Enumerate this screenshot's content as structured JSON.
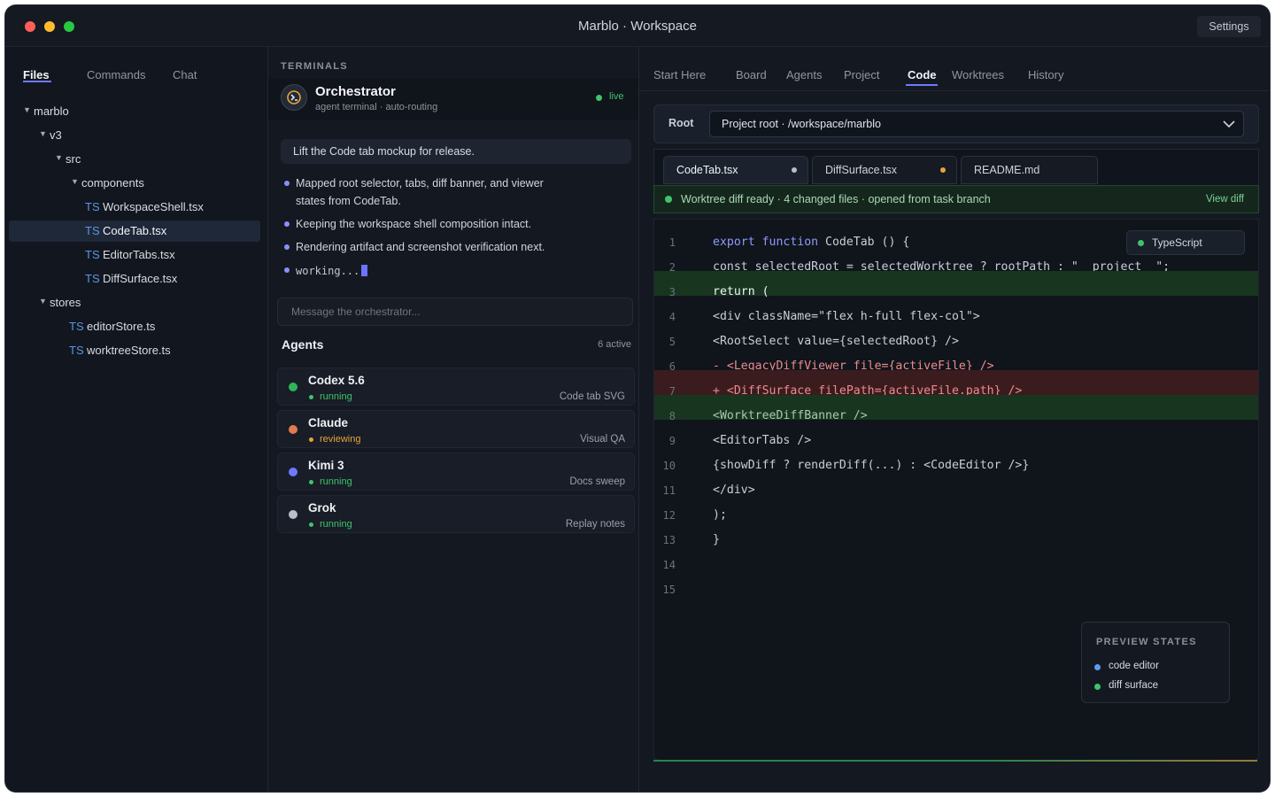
{
  "window": {
    "title": "Marblo · Workspace",
    "settings_label": "Settings",
    "traffic_lights": {
      "close": "#ff5f57",
      "minimize": "#febc2e",
      "zoom": "#28c840"
    }
  },
  "left": {
    "tabs": [
      {
        "label": "Files"
      },
      {
        "label": "Commands"
      },
      {
        "label": "Chat"
      }
    ],
    "tree": [
      {
        "label": "marblo",
        "type": "folder"
      },
      {
        "label": "v3",
        "type": "folder"
      },
      {
        "label": "src",
        "type": "folder"
      },
      {
        "label": "components",
        "type": "folder"
      },
      {
        "label": "WorkspaceShell.tsx",
        "type": "file",
        "badge": "TS"
      },
      {
        "label": "CodeTab.tsx",
        "type": "file",
        "badge": "TS"
      },
      {
        "label": "EditorTabs.tsx",
        "type": "file",
        "badge": "TS"
      },
      {
        "label": "DiffSurface.tsx",
        "type": "file",
        "badge": "TS"
      },
      {
        "label": "stores",
        "type": "folder"
      },
      {
        "label": "editorStore.ts",
        "type": "file",
        "badge": "TS"
      },
      {
        "label": "worktreeStore.ts",
        "type": "file",
        "badge": "TS"
      }
    ]
  },
  "mid": {
    "section_label": "TERMINALS",
    "orchestrator": {
      "name": "Orchestrator",
      "subtitle": "agent terminal · auto-routing",
      "status": "live"
    },
    "prompt": "Lift the Code tab mockup for release.",
    "bullets": [
      "Mapped root selector, tabs, diff banner, and viewer states from CodeTab.",
      "Keeping the workspace shell composition intact.",
      "Rendering artifact and screenshot verification next."
    ],
    "working": "working...",
    "input_placeholder": "Message the orchestrator...",
    "agents_title": "Agents",
    "agents_count": "6 active",
    "agents": [
      {
        "name": "Codex 5.6",
        "status": "running",
        "task": "Code tab SVG",
        "color": "#2fb45a",
        "status_color": "#3ec46b"
      },
      {
        "name": "Claude",
        "status": "reviewing",
        "task": "Visual QA",
        "color": "#e07b4f",
        "status_color": "#e8a33a"
      },
      {
        "name": "Kimi 3",
        "status": "running",
        "task": "Docs sweep",
        "color": "#6f78ff",
        "status_color": "#3ec46b"
      },
      {
        "name": "Grok",
        "status": "running",
        "task": "Replay notes",
        "color": "#b9bec8",
        "status_color": "#3ec46b"
      }
    ]
  },
  "right": {
    "tabs": [
      {
        "label": "Start Here"
      },
      {
        "label": "Board"
      },
      {
        "label": "Agents"
      },
      {
        "label": "Project"
      },
      {
        "label": "Code"
      },
      {
        "label": "Worktrees"
      },
      {
        "label": "History"
      }
    ],
    "root_label": "Root",
    "root_value": "Project root · /workspace/marblo",
    "file_tabs": [
      {
        "label": "CodeTab.tsx",
        "dirty_color": "#b9bec8"
      },
      {
        "label": "DiffSurface.tsx",
        "dirty_color": "#e8a33a"
      },
      {
        "label": "README.md"
      }
    ],
    "banner_text": "Worktree diff ready · 4 changed files · opened from task branch",
    "banner_link": "View diff",
    "language": "TypeScript",
    "code": [
      {
        "n": "1",
        "kw": "export function",
        "text": " CodeTab () {",
        "type": ""
      },
      {
        "n": "2",
        "text": "const selectedRoot = selectedWorktree ? rootPath : \"__project__\";",
        "type": ""
      },
      {
        "n": "3",
        "text": "return (",
        "type": "add"
      },
      {
        "n": "4",
        "text": "<div className=\"flex h-full flex-col\">",
        "type": ""
      },
      {
        "n": "5",
        "text": "<RootSelect value={selectedRoot} />",
        "type": ""
      },
      {
        "n": "6",
        "text": "- <LegacyDiffViewer file={activeFile} />",
        "type": "del"
      },
      {
        "n": "7",
        "text": "+ <DiffSurface filePath={activeFile.path} />",
        "type": "del"
      },
      {
        "n": "8",
        "text": "<WorktreeDiffBanner />",
        "type": "add"
      },
      {
        "n": "9",
        "text": "<EditorTabs />",
        "type": ""
      },
      {
        "n": "10",
        "text": "{showDiff ? renderDiff(...) : <CodeEditor />}",
        "type": ""
      },
      {
        "n": "11",
        "text": "</div>",
        "type": ""
      },
      {
        "n": "12",
        "text": ");",
        "type": ""
      },
      {
        "n": "13",
        "text": "}",
        "type": ""
      },
      {
        "n": "14",
        "text": "",
        "type": ""
      },
      {
        "n": "15",
        "text": "",
        "type": ""
      }
    ],
    "preview_title": "PREVIEW STATES",
    "preview_items": [
      {
        "label": "code editor",
        "color": "#5b9bf0"
      },
      {
        "label": "diff surface",
        "color": "#3ec46b"
      }
    ]
  }
}
